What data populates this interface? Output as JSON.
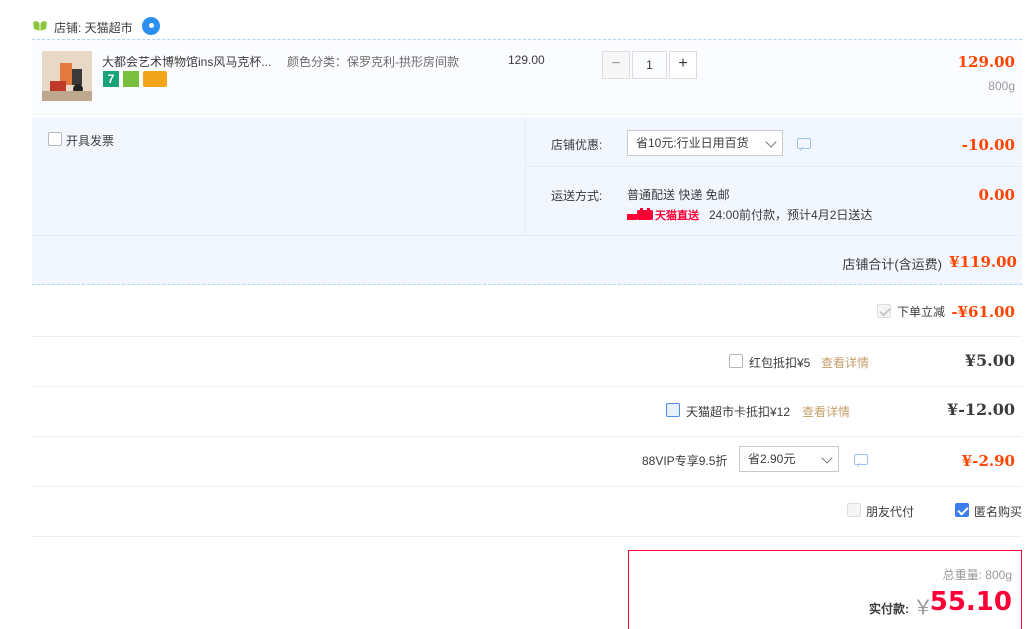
{
  "shop": {
    "label": "店铺: 天猫超市"
  },
  "item": {
    "title": "大都会艺术博物馆ins风马克杯...",
    "sku": "颜色分类：保罗克利-拱形房间款",
    "unit_price": "129.00",
    "quantity": "1",
    "qty_minus": "−",
    "qty_plus": "+",
    "subtotal": "129.00",
    "weight": "800g",
    "badges": [
      "7",
      "icon",
      "card"
    ]
  },
  "invoice": {
    "label": "开具发票"
  },
  "shop_promo": {
    "label": "店铺优惠:",
    "selected": "省10元:行业日用百货",
    "amount": "-10.00"
  },
  "shipping": {
    "label": "运送方式:",
    "method": "普通配送 快递 免邮",
    "logo": "天猫直送",
    "eta": "24:00前付款，预计4月2日送达",
    "amount": "0.00"
  },
  "shop_total": {
    "label": "店铺合计(含运费)",
    "value": "¥119.00"
  },
  "instant_discount": {
    "label": "下单立减",
    "value": "-¥61.00"
  },
  "red_packet": {
    "label": "红包抵扣¥5",
    "link": "查看详情",
    "value": "¥5.00"
  },
  "tmall_card": {
    "label": "天猫超市卡抵扣¥12",
    "link": "查看详情",
    "value": "¥-12.00"
  },
  "vip": {
    "label": "88VIP专享9.5折",
    "selected": "省2.90元",
    "value": "¥-2.90"
  },
  "options": {
    "friend_pay": "朋友代付",
    "anonymous": "匿名购买"
  },
  "summary": {
    "weight": "总重量: 800g",
    "pay_label": "实付款:",
    "yen": "￥",
    "pay_value": "55.10"
  },
  "colors": {
    "price_red": "#ff4400",
    "accent_red": "#ff0036",
    "link_gold": "#c59d6a",
    "panel_blue": "#f2f7ff"
  }
}
